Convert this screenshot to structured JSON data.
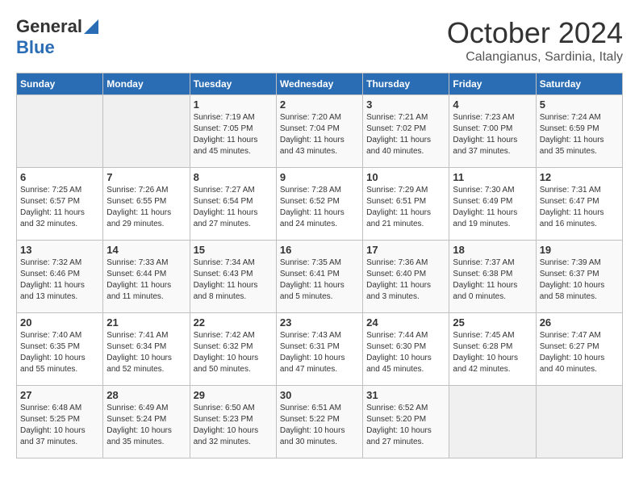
{
  "header": {
    "logo_general": "General",
    "logo_blue": "Blue",
    "month_title": "October 2024",
    "subtitle": "Calangianus, Sardinia, Italy"
  },
  "calendar": {
    "days_of_week": [
      "Sunday",
      "Monday",
      "Tuesday",
      "Wednesday",
      "Thursday",
      "Friday",
      "Saturday"
    ],
    "weeks": [
      [
        {
          "day": "",
          "info": ""
        },
        {
          "day": "",
          "info": ""
        },
        {
          "day": "1",
          "info": "Sunrise: 7:19 AM\nSunset: 7:05 PM\nDaylight: 11 hours and 45 minutes."
        },
        {
          "day": "2",
          "info": "Sunrise: 7:20 AM\nSunset: 7:04 PM\nDaylight: 11 hours and 43 minutes."
        },
        {
          "day": "3",
          "info": "Sunrise: 7:21 AM\nSunset: 7:02 PM\nDaylight: 11 hours and 40 minutes."
        },
        {
          "day": "4",
          "info": "Sunrise: 7:23 AM\nSunset: 7:00 PM\nDaylight: 11 hours and 37 minutes."
        },
        {
          "day": "5",
          "info": "Sunrise: 7:24 AM\nSunset: 6:59 PM\nDaylight: 11 hours and 35 minutes."
        }
      ],
      [
        {
          "day": "6",
          "info": "Sunrise: 7:25 AM\nSunset: 6:57 PM\nDaylight: 11 hours and 32 minutes."
        },
        {
          "day": "7",
          "info": "Sunrise: 7:26 AM\nSunset: 6:55 PM\nDaylight: 11 hours and 29 minutes."
        },
        {
          "day": "8",
          "info": "Sunrise: 7:27 AM\nSunset: 6:54 PM\nDaylight: 11 hours and 27 minutes."
        },
        {
          "day": "9",
          "info": "Sunrise: 7:28 AM\nSunset: 6:52 PM\nDaylight: 11 hours and 24 minutes."
        },
        {
          "day": "10",
          "info": "Sunrise: 7:29 AM\nSunset: 6:51 PM\nDaylight: 11 hours and 21 minutes."
        },
        {
          "day": "11",
          "info": "Sunrise: 7:30 AM\nSunset: 6:49 PM\nDaylight: 11 hours and 19 minutes."
        },
        {
          "day": "12",
          "info": "Sunrise: 7:31 AM\nSunset: 6:47 PM\nDaylight: 11 hours and 16 minutes."
        }
      ],
      [
        {
          "day": "13",
          "info": "Sunrise: 7:32 AM\nSunset: 6:46 PM\nDaylight: 11 hours and 13 minutes."
        },
        {
          "day": "14",
          "info": "Sunrise: 7:33 AM\nSunset: 6:44 PM\nDaylight: 11 hours and 11 minutes."
        },
        {
          "day": "15",
          "info": "Sunrise: 7:34 AM\nSunset: 6:43 PM\nDaylight: 11 hours and 8 minutes."
        },
        {
          "day": "16",
          "info": "Sunrise: 7:35 AM\nSunset: 6:41 PM\nDaylight: 11 hours and 5 minutes."
        },
        {
          "day": "17",
          "info": "Sunrise: 7:36 AM\nSunset: 6:40 PM\nDaylight: 11 hours and 3 minutes."
        },
        {
          "day": "18",
          "info": "Sunrise: 7:37 AM\nSunset: 6:38 PM\nDaylight: 11 hours and 0 minutes."
        },
        {
          "day": "19",
          "info": "Sunrise: 7:39 AM\nSunset: 6:37 PM\nDaylight: 10 hours and 58 minutes."
        }
      ],
      [
        {
          "day": "20",
          "info": "Sunrise: 7:40 AM\nSunset: 6:35 PM\nDaylight: 10 hours and 55 minutes."
        },
        {
          "day": "21",
          "info": "Sunrise: 7:41 AM\nSunset: 6:34 PM\nDaylight: 10 hours and 52 minutes."
        },
        {
          "day": "22",
          "info": "Sunrise: 7:42 AM\nSunset: 6:32 PM\nDaylight: 10 hours and 50 minutes."
        },
        {
          "day": "23",
          "info": "Sunrise: 7:43 AM\nSunset: 6:31 PM\nDaylight: 10 hours and 47 minutes."
        },
        {
          "day": "24",
          "info": "Sunrise: 7:44 AM\nSunset: 6:30 PM\nDaylight: 10 hours and 45 minutes."
        },
        {
          "day": "25",
          "info": "Sunrise: 7:45 AM\nSunset: 6:28 PM\nDaylight: 10 hours and 42 minutes."
        },
        {
          "day": "26",
          "info": "Sunrise: 7:47 AM\nSunset: 6:27 PM\nDaylight: 10 hours and 40 minutes."
        }
      ],
      [
        {
          "day": "27",
          "info": "Sunrise: 6:48 AM\nSunset: 5:25 PM\nDaylight: 10 hours and 37 minutes."
        },
        {
          "day": "28",
          "info": "Sunrise: 6:49 AM\nSunset: 5:24 PM\nDaylight: 10 hours and 35 minutes."
        },
        {
          "day": "29",
          "info": "Sunrise: 6:50 AM\nSunset: 5:23 PM\nDaylight: 10 hours and 32 minutes."
        },
        {
          "day": "30",
          "info": "Sunrise: 6:51 AM\nSunset: 5:22 PM\nDaylight: 10 hours and 30 minutes."
        },
        {
          "day": "31",
          "info": "Sunrise: 6:52 AM\nSunset: 5:20 PM\nDaylight: 10 hours and 27 minutes."
        },
        {
          "day": "",
          "info": ""
        },
        {
          "day": "",
          "info": ""
        }
      ]
    ]
  }
}
